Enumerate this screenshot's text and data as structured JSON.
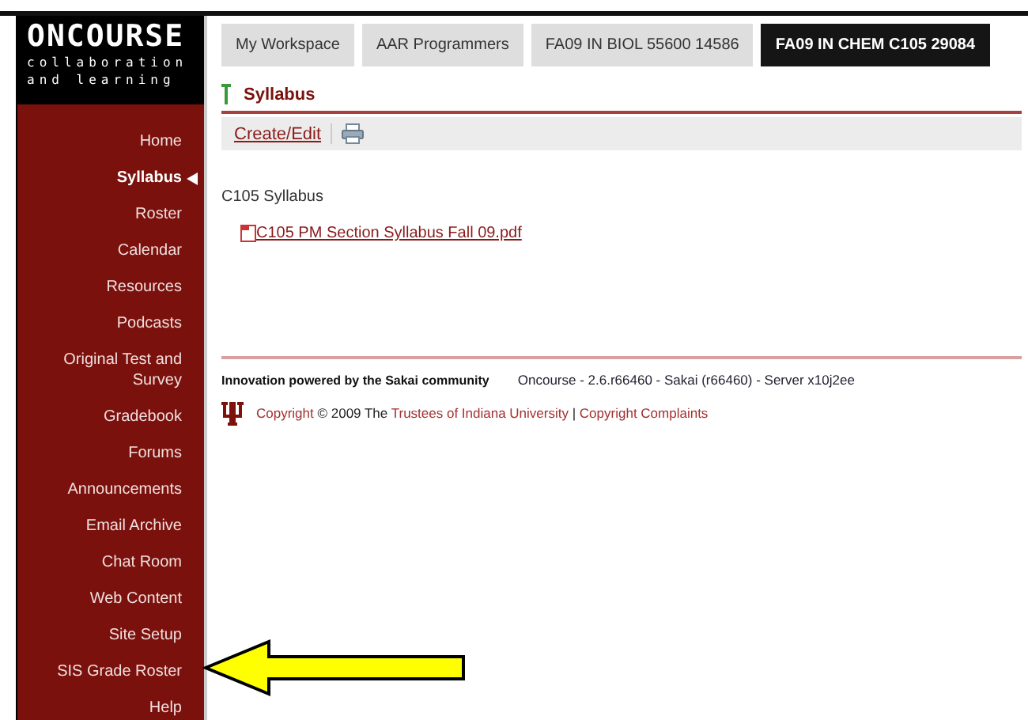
{
  "logo": {
    "name": "ONCOURSE",
    "tagline_1": "collaboration",
    "tagline_2": "and learning"
  },
  "tabs": [
    {
      "label": "My Workspace",
      "selected": false
    },
    {
      "label": "AAR Programmers",
      "selected": false
    },
    {
      "label": "FA09 IN BIOL 55600 14586",
      "selected": false
    },
    {
      "label": "FA09 IN CHEM C105 29084",
      "selected": true
    }
  ],
  "sidebar": {
    "items": [
      {
        "label": "Home",
        "selected": false
      },
      {
        "label": "Syllabus",
        "selected": true
      },
      {
        "label": "Roster",
        "selected": false
      },
      {
        "label": "Calendar",
        "selected": false
      },
      {
        "label": "Resources",
        "selected": false
      },
      {
        "label": "Podcasts",
        "selected": false
      },
      {
        "label": "Original Test and Survey",
        "selected": false
      },
      {
        "label": "Gradebook",
        "selected": false
      },
      {
        "label": "Forums",
        "selected": false
      },
      {
        "label": "Announcements",
        "selected": false
      },
      {
        "label": "Email Archive",
        "selected": false
      },
      {
        "label": "Chat Room",
        "selected": false
      },
      {
        "label": "Web Content",
        "selected": false
      },
      {
        "label": "Site Setup",
        "selected": false
      },
      {
        "label": "SIS Grade Roster",
        "selected": false
      },
      {
        "label": "Help",
        "selected": false
      }
    ]
  },
  "tool": {
    "title": "Syllabus",
    "toolbar_link": "Create/Edit"
  },
  "content": {
    "heading": "C105 Syllabus",
    "file_link": "C105 PM Section Syllabus Fall 09.pdf"
  },
  "footer": {
    "powered_by": "Innovation powered by the Sakai community",
    "server_info": "Oncourse - 2.6.r66460 - Sakai (r66460) - Server x10j2ee",
    "copyright": [
      {
        "kind": "link",
        "text": "Copyright"
      },
      {
        "kind": "text",
        "text": " © 2009 The "
      },
      {
        "kind": "link",
        "text": "Trustees of Indiana University"
      },
      {
        "kind": "text",
        "text": " | "
      },
      {
        "kind": "link",
        "text": "Copyright Complaints"
      }
    ]
  },
  "annotation": {
    "kind": "arrow"
  }
}
